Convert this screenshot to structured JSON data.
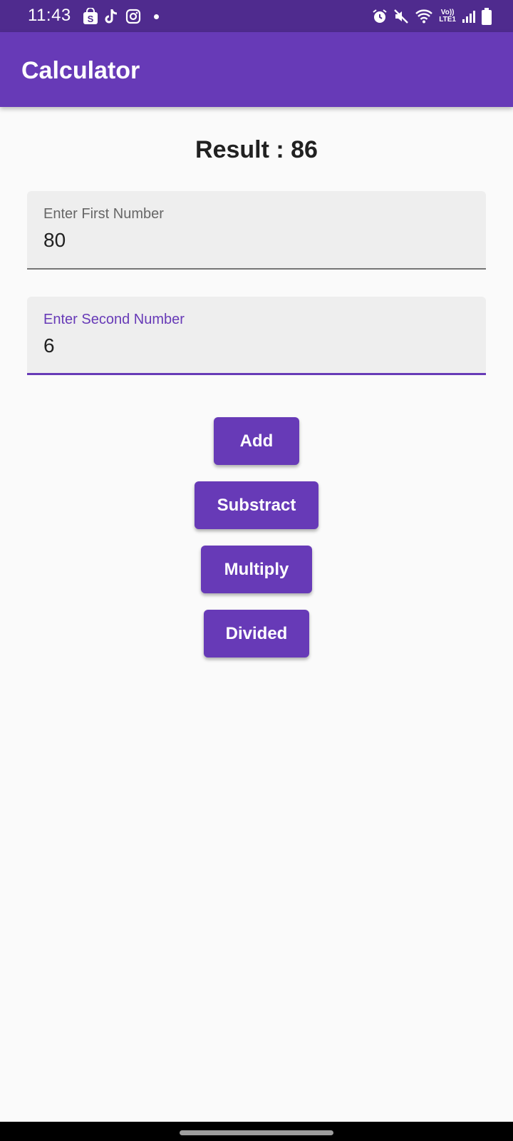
{
  "status_bar": {
    "time": "11:43",
    "network_label_top": "Vo))",
    "network_label_bottom": "LTE1",
    "left_icons": [
      "shop-icon",
      "tiktok-icon",
      "instagram-icon",
      "notification-dot-icon"
    ],
    "right_icons": [
      "alarm-icon",
      "mute-icon",
      "wifi-icon",
      "signal-icon",
      "battery-icon"
    ]
  },
  "app_bar": {
    "title": "Calculator"
  },
  "result": {
    "text": "Result : 86"
  },
  "fields": {
    "first": {
      "label": "Enter First Number",
      "value": "80"
    },
    "second": {
      "label": "Enter Second Number",
      "value": "6"
    }
  },
  "buttons": {
    "add": "Add",
    "subtract": "Substract",
    "multiply": "Multiply",
    "divide": "Divided"
  },
  "colors": {
    "primary": "#673ab7",
    "status_bar": "#4f2b8e",
    "background": "#fafafa",
    "field_fill": "#eeeeee"
  }
}
